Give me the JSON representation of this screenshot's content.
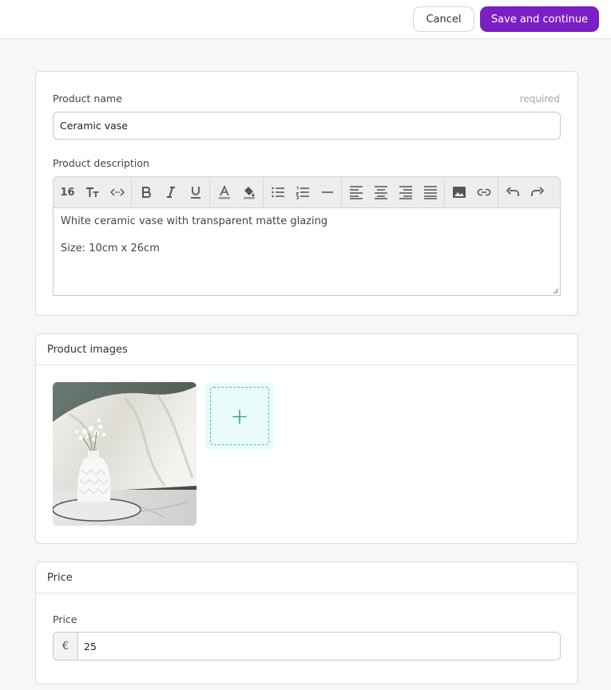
{
  "header": {
    "cancel_label": "Cancel",
    "save_label": "Save and continue"
  },
  "details": {
    "name_label": "Product name",
    "required_label": "required",
    "name_value": "Ceramic vase",
    "description_label": "Product description",
    "toolbar": {
      "font_size": "16",
      "buttons": [
        "font-size",
        "text-case",
        "code-view",
        "bold",
        "italic",
        "underline",
        "font-color",
        "highlight-color",
        "bulleted-list",
        "numbered-list",
        "horizontal-rule",
        "align-left",
        "align-center",
        "align-right",
        "justify",
        "insert-image",
        "insert-link",
        "undo",
        "redo"
      ]
    },
    "description_lines": [
      "White ceramic vase with transparent matte glazing",
      "Size: 10cm x 26cm"
    ]
  },
  "images": {
    "title": "Product images",
    "add_label": "+"
  },
  "price": {
    "title": "Price",
    "field_label": "Price",
    "currency": "€",
    "value": "25"
  },
  "colors": {
    "accent": "#7a1fc4",
    "add_tile_bg": "#e9fbfb",
    "add_tile_border": "#4cc3a9"
  }
}
